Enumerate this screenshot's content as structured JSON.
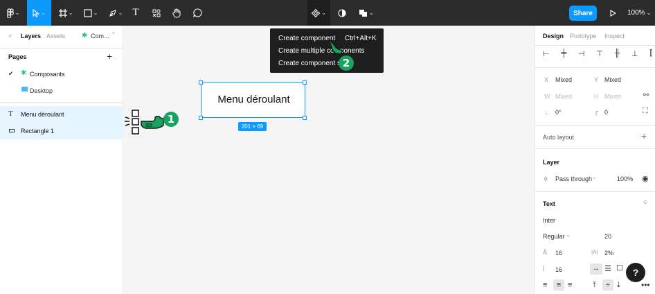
{
  "toolbar": {
    "menu_label": "F",
    "text_tool": "T",
    "share_label": "Share",
    "zoom_label": "100%",
    "play_icon": "play-icon"
  },
  "left_panel": {
    "tab_layers": "Layers",
    "tab_assets": "Assets",
    "page_name": "Com...",
    "pages_heading": "Pages",
    "add_page": "+",
    "pages": [
      {
        "label": "Composants",
        "current": true
      },
      {
        "label": "Desktop",
        "current": false
      }
    ],
    "layers": [
      {
        "label": "Menu déroulant",
        "icon": "text-icon"
      },
      {
        "label": "Rectangle 1",
        "icon": "rectangle-icon"
      }
    ]
  },
  "context_menu": {
    "items": [
      {
        "label": "Create component",
        "shortcut": "Ctrl+Alt+K"
      },
      {
        "label": "Create multiple components",
        "shortcut": ""
      },
      {
        "label": "Create component set",
        "shortcut": ""
      }
    ]
  },
  "canvas": {
    "frame_text": "Menu déroulant",
    "dimensions": "201 × 69"
  },
  "annotations": {
    "step1": "1",
    "step2": "2"
  },
  "right_panel": {
    "tabs": [
      "Design",
      "Prototype",
      "Inspect"
    ],
    "x_label": "X",
    "x_value": "Mixed",
    "y_label": "Y",
    "y_value": "Mixed",
    "w_label": "W",
    "w_value": "Mixed",
    "h_label": "H",
    "h_value": "Mixed",
    "rotation": "0°",
    "radius": "0",
    "auto_layout": "Auto layout",
    "layer_heading": "Layer",
    "blend_mode": "Pass through",
    "opacity": "100%",
    "text_heading": "Text",
    "font_family": "Inter",
    "font_weight": "Regular",
    "font_size": "20",
    "line_height": "16",
    "letter_spacing": "2%",
    "paragraph_spacing": "16",
    "help": "?"
  },
  "colors": {
    "accent": "#0d99ff",
    "toolbar": "#2c2c2c",
    "menu": "#1e1e1e",
    "badge": "#1aa260"
  }
}
